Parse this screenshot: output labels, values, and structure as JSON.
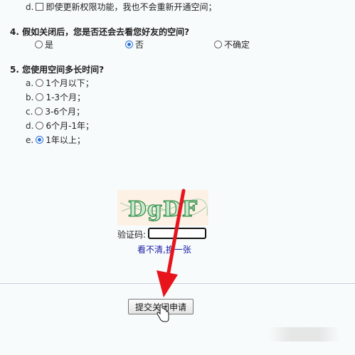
{
  "q3": {
    "option_d": {
      "letter": "d.",
      "label": "即使更新权限功能，我也不会重新开通空间；"
    }
  },
  "q4": {
    "title": "4. 假如关闭后，您是否还会去看您好友的空间?",
    "options": [
      {
        "label": "是",
        "selected": false
      },
      {
        "label": "否",
        "selected": true
      },
      {
        "label": "不确定",
        "selected": false
      }
    ]
  },
  "q5": {
    "title": "5. 您使用空间多长时间?",
    "options": [
      {
        "letter": "a.",
        "label": "1个月以下；",
        "selected": false
      },
      {
        "letter": "b.",
        "label": "1-3个月；",
        "selected": false
      },
      {
        "letter": "c.",
        "label": "3-6个月；",
        "selected": false
      },
      {
        "letter": "d.",
        "label": "6个月-1年；",
        "selected": false
      },
      {
        "letter": "e.",
        "label": "1年以上；",
        "selected": true
      }
    ]
  },
  "captcha": {
    "image_text": "DgDF",
    "label": "验证码:",
    "input_value": "",
    "refresh_link": "看不清,换一张"
  },
  "submit_label": "提交关闭申请",
  "colors": {
    "accent": "#2a6fd6",
    "arrow": "#e8141c",
    "link": "#1a1aa6"
  }
}
